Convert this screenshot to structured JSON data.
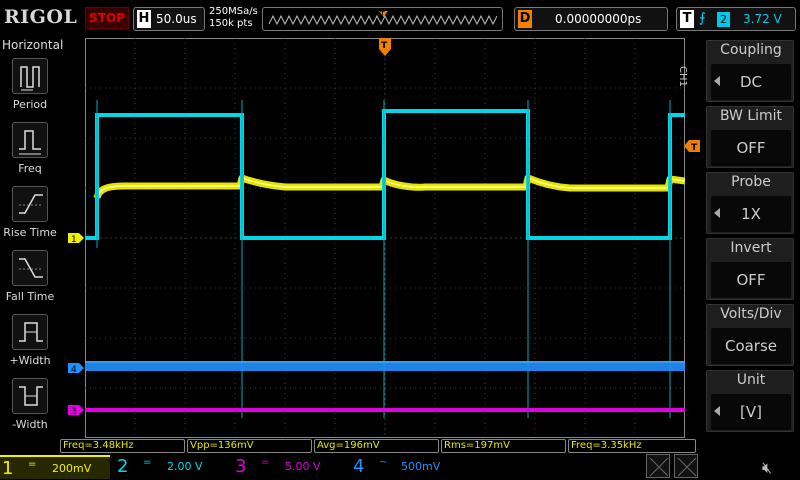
{
  "brand": "RIGOL",
  "run_state": "STOP",
  "timebase": {
    "label": "H",
    "value": "50.0us"
  },
  "sampling": {
    "rate": "250MSa/s",
    "points": "150k pts"
  },
  "trigger_position_marker": "T",
  "delay": {
    "label": "D",
    "value": "0.00000000ps"
  },
  "trigger": {
    "label": "T",
    "edge": "rising-edge-icon",
    "source": "2",
    "level": "3.72 V"
  },
  "horizontal_menu": {
    "title": "Horizontal",
    "items": [
      {
        "label": "Period",
        "icon": "period-icon"
      },
      {
        "label": "Freq",
        "icon": "frequency-icon"
      },
      {
        "label": "Rise Time",
        "icon": "rise-time-icon"
      },
      {
        "label": "Fall Time",
        "icon": "fall-time-icon"
      },
      {
        "label": "+Width",
        "icon": "positive-width-icon"
      },
      {
        "label": "-Width",
        "icon": "negative-width-icon"
      }
    ]
  },
  "channel_menu": {
    "tag": "CH1",
    "items": [
      {
        "title": "Coupling",
        "value": "DC"
      },
      {
        "title": "BW Limit",
        "value": "OFF"
      },
      {
        "title": "Probe",
        "value": "1X"
      },
      {
        "title": "Invert",
        "value": "OFF"
      },
      {
        "title": "Volts/Div",
        "value": "Coarse"
      },
      {
        "title": "Unit",
        "value": "[V]"
      }
    ]
  },
  "markers": {
    "ch1": "1",
    "ch4": "4",
    "ch3": "3",
    "trigger_level": "T"
  },
  "measurements": [
    {
      "text": "Freq=3.48kHz"
    },
    {
      "text": "Vpp=136mV"
    },
    {
      "text": "Avg=196mV"
    },
    {
      "text": "Rms=197mV"
    },
    {
      "text": "Freq=3.35kHz"
    }
  ],
  "channels": [
    {
      "num": "1",
      "coupling": "=",
      "scale": "200mV",
      "color": "#f0f000"
    },
    {
      "num": "2",
      "coupling": "=",
      "scale": "2.00 V",
      "color": "#00d8e8"
    },
    {
      "num": "3",
      "coupling": "=",
      "scale": "5.00 V",
      "color": "#e000e0"
    },
    {
      "num": "4",
      "coupling": "~",
      "scale": "500mV",
      "color": "#1e90ff"
    }
  ],
  "colors": {
    "ch1": "#f0f000",
    "ch2": "#00d8e8",
    "ch3": "#e000e0",
    "ch4": "#1e90ff",
    "trigger": "#f08000",
    "grid": "#3a3a3a"
  }
}
